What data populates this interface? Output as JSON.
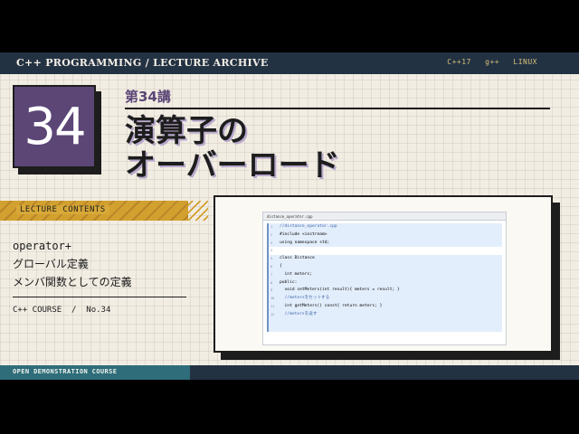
{
  "header": {
    "title": "C++ PROGRAMMING / LECTURE ARCHIVE",
    "meta": "C++17 g++ LINUX"
  },
  "lecture": {
    "number": "34",
    "label": "第34講",
    "title_line1": "演算子の",
    "title_line2": "オーバーロード"
  },
  "contents": {
    "heading": "LECTURE CONTENTS",
    "items": [
      "operator+",
      "グローバル定義",
      "メンバ関数としての定義"
    ]
  },
  "course": {
    "label": "C++ COURSE  /  No.34"
  },
  "editor": {
    "tab": "distance_operator.cpp",
    "lines": [
      {
        "n": "1",
        "text": "//distance_operator.cpp"
      },
      {
        "n": "2",
        "text": "#include <iostream>"
      },
      {
        "n": "3",
        "text": "using namespace std;"
      },
      {
        "n": "4",
        "text": ""
      },
      {
        "n": "5",
        "text": "class Distance"
      },
      {
        "n": "6",
        "text": "{"
      },
      {
        "n": "7",
        "text": "  int meters;"
      },
      {
        "n": "8",
        "text": "public:"
      },
      {
        "n": "9",
        "text": "  void setMeters(int result){ meters = result; }"
      },
      {
        "n": "10",
        "text": "  //metersをセットする"
      },
      {
        "n": "11",
        "text": "  int getMeters() const{ return meters; }"
      },
      {
        "n": "12",
        "text": "  //metersを返す"
      }
    ]
  },
  "footer": {
    "label": "OPEN DEMONSTRATION COURSE"
  },
  "colors": {
    "accent_purple": "#5b4676",
    "navy": "#233243",
    "teal": "#2e6d79",
    "yellow": "#d2a02e",
    "paper": "#f2ede3"
  }
}
